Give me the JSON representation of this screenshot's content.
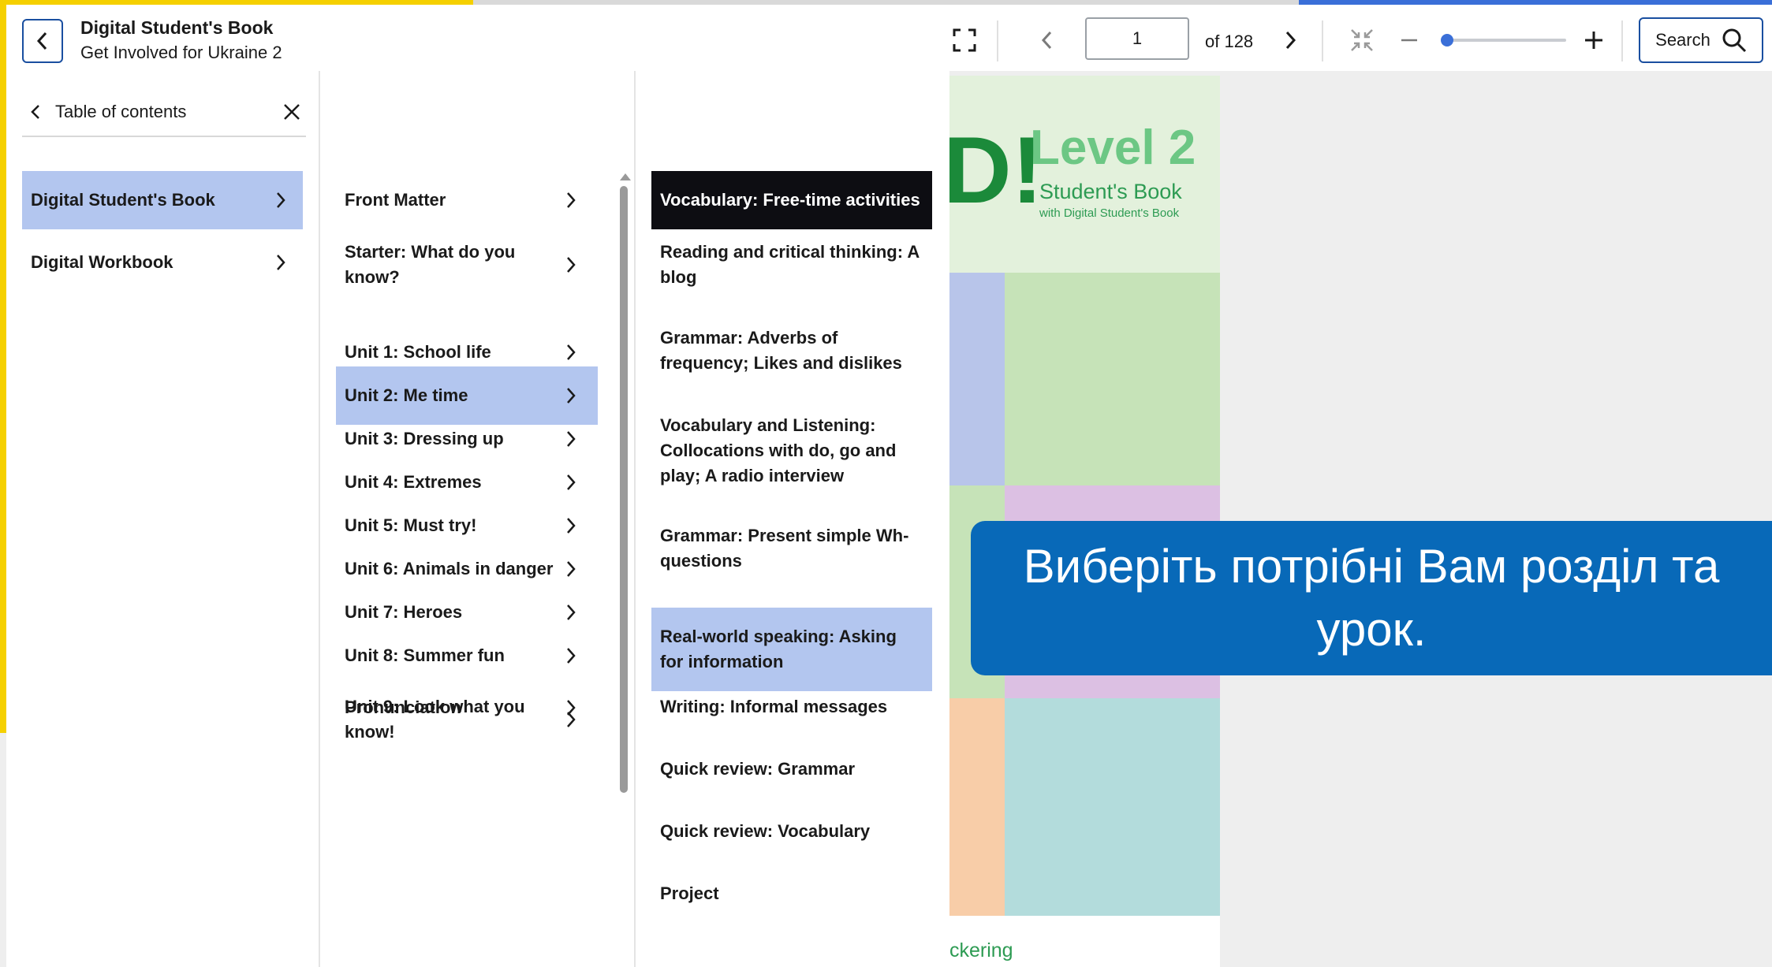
{
  "header": {
    "title": "Digital Student's Book",
    "subtitle": "Get Involved for Ukraine 2",
    "page_value": "1",
    "page_total": "of 128",
    "zoom_level": 0.0,
    "search_label": "Search"
  },
  "icons": {
    "back": "chevron-left-icon",
    "fullscreen": "fullscreen-icon",
    "prev": "chevron-left-icon",
    "next": "chevron-right-icon",
    "fit": "collapse-icon",
    "zoom_out": "minus-icon",
    "zoom_in": "plus-icon",
    "search": "search-icon"
  },
  "toc": {
    "heading": "Table of contents",
    "books": [
      {
        "label": "Digital Student's Book",
        "selected": true
      },
      {
        "label": "Digital Workbook",
        "selected": false
      }
    ],
    "units": [
      {
        "label": "Front Matter"
      },
      {
        "label": "Starter: What do you know?"
      },
      {
        "label": "Unit 1: School life"
      },
      {
        "label": "Unit 2: Me time",
        "selected": true
      },
      {
        "label": "Unit 3: Dressing up"
      },
      {
        "label": "Unit 4: Extremes"
      },
      {
        "label": "Unit 5: Must try!"
      },
      {
        "label": "Unit 6: Animals in danger"
      },
      {
        "label": "Unit 7: Heroes"
      },
      {
        "label": "Unit 8: Summer fun"
      },
      {
        "label": "Unit 9: Look what you know!"
      },
      {
        "label": "Pronunciation"
      }
    ],
    "lessons": [
      {
        "label": "Vocabulary: Free-time activities",
        "active": true
      },
      {
        "label": "Reading and critical thinking: A blog"
      },
      {
        "label": "Grammar: Adverbs of frequency; Likes and dislikes"
      },
      {
        "label": "Vocabulary and Listening: Collocations with do, go and play; A radio interview"
      },
      {
        "label": "Grammar: Present simple Wh-questions"
      },
      {
        "label": "Real-world speaking: Asking for information",
        "selected": true
      },
      {
        "label": "Writing: Informal messages"
      },
      {
        "label": "Quick review: Grammar"
      },
      {
        "label": "Quick review: Vocabulary"
      },
      {
        "label": "Project"
      }
    ]
  },
  "cover": {
    "logo_fragment": "D!",
    "level": "Level 2",
    "book_type": "Student's Book",
    "with_text": "with Digital Student's Book",
    "author_fragment": "ckering"
  },
  "tooltip": {
    "text": "Виберіть потрібні Вам розділ та урок."
  },
  "colors": {
    "accent_blue": "#1a4fa0",
    "selection": "#b3c6ef",
    "active_item": "#0d0d12",
    "tooltip_bg": "#0869b8",
    "cover_green": "#2d9b53"
  }
}
